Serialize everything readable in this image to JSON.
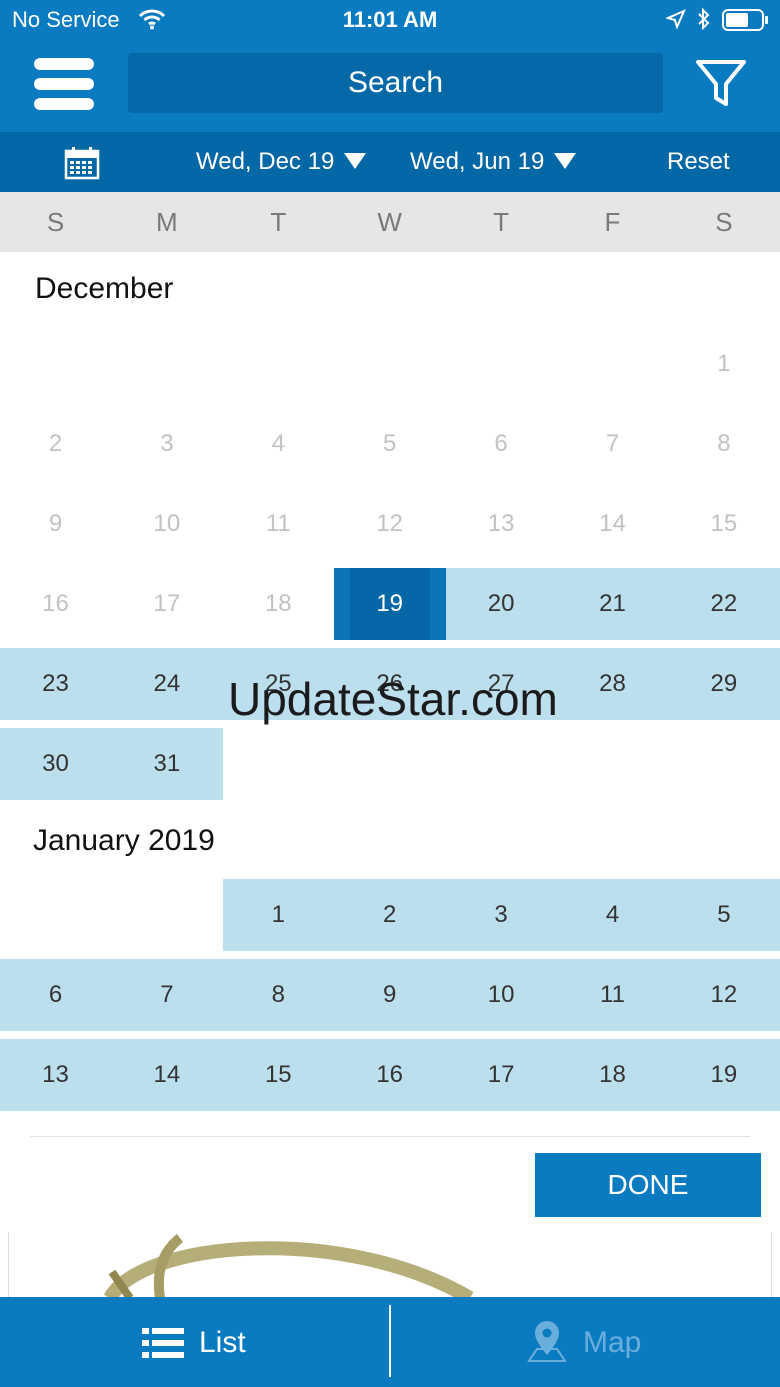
{
  "status_bar": {
    "carrier": "No Service",
    "time": "11:01 AM",
    "icons": [
      "wifi-icon",
      "location-arrow-icon",
      "bluetooth-icon",
      "battery-icon"
    ]
  },
  "nav": {
    "search_placeholder": "Search",
    "menu_icon": "hamburger-menu-icon",
    "filter_icon": "filter-funnel-icon"
  },
  "range_bar": {
    "calendar_icon": "calendar-icon",
    "start_date": "Wed, Dec 19",
    "end_date": "Wed, Jun 19",
    "reset_label": "Reset"
  },
  "weekdays": [
    "S",
    "M",
    "T",
    "W",
    "T",
    "F",
    "S"
  ],
  "months": [
    {
      "title": "December",
      "selected_day": "19",
      "rows": [
        [
          null,
          null,
          null,
          null,
          null,
          null,
          "1"
        ],
        [
          "2",
          "3",
          "4",
          "5",
          "6",
          "7",
          "8"
        ],
        [
          "9",
          "10",
          "11",
          "12",
          "13",
          "14",
          "15"
        ],
        [
          "16",
          "17",
          "18",
          "19",
          "20",
          "21",
          "22"
        ],
        [
          "23",
          "24",
          "25",
          "26",
          "27",
          "28",
          "29"
        ],
        [
          "30",
          "31",
          null,
          null,
          null,
          null,
          null
        ]
      ]
    },
    {
      "title": "January 2019",
      "rows": [
        [
          null,
          null,
          "1",
          "2",
          "3",
          "4",
          "5"
        ],
        [
          "6",
          "7",
          "8",
          "9",
          "10",
          "11",
          "12"
        ],
        [
          "13",
          "14",
          "15",
          "16",
          "17",
          "18",
          "19"
        ]
      ]
    }
  ],
  "watermark": "UpdateStar.com",
  "done_label": "DONE",
  "tabs": [
    {
      "label": "List",
      "icon": "list-icon",
      "active": true
    },
    {
      "label": "Map",
      "icon": "map-pin-icon",
      "active": false
    }
  ],
  "colors": {
    "primary": "#0a7bc1",
    "range_bar": "#0568a6",
    "range_highlight": "#bcdfee",
    "selected": "#0567a6",
    "disabled_text": "#c2c2c2"
  }
}
